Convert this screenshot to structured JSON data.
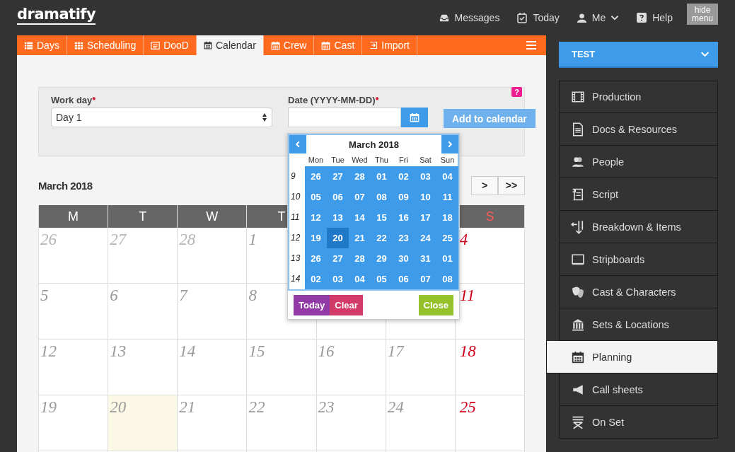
{
  "top_bar": {
    "logo": "dramatify",
    "links": [
      {
        "label": "Messages"
      },
      {
        "label": "Today"
      },
      {
        "label": "Me"
      },
      {
        "label": "Help"
      }
    ],
    "hide_menu": "hide menu"
  },
  "tabs": [
    {
      "label": "Days",
      "selected": false
    },
    {
      "label": "Scheduling",
      "selected": false
    },
    {
      "label": "DooD",
      "selected": false
    },
    {
      "label": "Calendar",
      "selected": true
    },
    {
      "label": "Crew",
      "selected": false
    },
    {
      "label": "Cast",
      "selected": false
    },
    {
      "label": "Import",
      "selected": false
    }
  ],
  "form": {
    "work_day": {
      "label": "Work day",
      "required_mark": "*",
      "value": "Day 1"
    },
    "date": {
      "label": "Date (YYYY-MM-DD)",
      "required_mark": "*"
    },
    "add_button": "Add to calendar",
    "help_badge": "?"
  },
  "calendar": {
    "title": "March 2018",
    "nav_buttons": [
      {
        "label": ">"
      },
      {
        "label": ">>"
      }
    ],
    "columns": [
      {
        "label": "M"
      },
      {
        "label": "T"
      },
      {
        "label": "W"
      },
      {
        "label": "T"
      },
      {},
      {},
      {
        "label": "S"
      }
    ],
    "weeks": [
      {
        "days": [
          {
            "day": "26",
            "other_month": true,
            "today": false
          },
          {
            "day": "27",
            "other_month": true,
            "today": false
          },
          {
            "day": "28",
            "other_month": true,
            "today": false
          },
          {
            "day": "1",
            "other_month": false,
            "today": false
          },
          {
            "day": "4",
            "other_month": false,
            "today": false
          }
        ]
      },
      {
        "days": [
          {
            "day": "5",
            "other_month": false,
            "today": false
          },
          {
            "day": "6",
            "other_month": false,
            "today": false
          },
          {
            "day": "7",
            "other_month": false,
            "today": false
          },
          {
            "day": "8",
            "other_month": false,
            "today": false
          },
          {
            "day": "11",
            "other_month": false,
            "today": false
          }
        ]
      },
      {
        "days": [
          {
            "day": "12",
            "other_month": false,
            "today": false
          },
          {
            "day": "13",
            "other_month": false,
            "today": false
          },
          {
            "day": "14",
            "other_month": false,
            "today": false
          },
          {
            "day": "15",
            "other_month": false,
            "today": false
          },
          {
            "day": "16",
            "other_month": false,
            "today": false
          },
          {
            "day": "17",
            "other_month": false,
            "today": false
          },
          {
            "day": "18",
            "other_month": false,
            "today": false
          }
        ]
      },
      {
        "days": [
          {
            "day": "19",
            "other_month": false,
            "today": false
          },
          {
            "day": "20",
            "other_month": false,
            "today": true
          },
          {
            "day": "21",
            "other_month": false,
            "today": false
          },
          {
            "day": "22",
            "other_month": false,
            "today": false
          },
          {
            "day": "23",
            "other_month": false,
            "today": false
          },
          {
            "day": "24",
            "other_month": false,
            "today": false
          },
          {
            "day": "25",
            "other_month": false,
            "today": false
          }
        ]
      }
    ]
  },
  "date_picker": {
    "title": "March 2018",
    "weekdays": [
      "Mon",
      "Tue",
      "Wed",
      "Thu",
      "Fri",
      "Sat",
      "Sun"
    ],
    "weeks": [
      {
        "number": "9",
        "days": [
          {
            "label": "26",
            "selected": false
          },
          {
            "label": "27",
            "selected": false
          },
          {
            "label": "28",
            "selected": false
          },
          {
            "label": "01",
            "selected": false
          },
          {
            "label": "02",
            "selected": false
          },
          {
            "label": "03",
            "selected": false
          },
          {
            "label": "04",
            "selected": false
          }
        ]
      },
      {
        "number": "10",
        "days": [
          {
            "label": "05",
            "selected": false
          },
          {
            "label": "06",
            "selected": false
          },
          {
            "label": "07",
            "selected": false
          },
          {
            "label": "08",
            "selected": false
          },
          {
            "label": "09",
            "selected": false
          },
          {
            "label": "10",
            "selected": false
          },
          {
            "label": "11",
            "selected": false
          }
        ]
      },
      {
        "number": "11",
        "days": [
          {
            "label": "12",
            "selected": false
          },
          {
            "label": "13",
            "selected": false
          },
          {
            "label": "14",
            "selected": false
          },
          {
            "label": "15",
            "selected": false
          },
          {
            "label": "16",
            "selected": false
          },
          {
            "label": "17",
            "selected": false
          },
          {
            "label": "18",
            "selected": false
          }
        ]
      },
      {
        "number": "12",
        "days": [
          {
            "label": "19",
            "selected": false
          },
          {
            "label": "20",
            "selected": true
          },
          {
            "label": "21",
            "selected": false
          },
          {
            "label": "22",
            "selected": false
          },
          {
            "label": "23",
            "selected": false
          },
          {
            "label": "24",
            "selected": false
          },
          {
            "label": "25",
            "selected": false
          }
        ]
      },
      {
        "number": "13",
        "days": [
          {
            "label": "26",
            "selected": false
          },
          {
            "label": "27",
            "selected": false
          },
          {
            "label": "28",
            "selected": false
          },
          {
            "label": "29",
            "selected": false
          },
          {
            "label": "30",
            "selected": false
          },
          {
            "label": "31",
            "selected": false
          },
          {
            "label": "01",
            "selected": false
          }
        ]
      },
      {
        "number": "14",
        "days": [
          {
            "label": "02",
            "selected": false
          },
          {
            "label": "03",
            "selected": false
          },
          {
            "label": "04",
            "selected": false
          },
          {
            "label": "05",
            "selected": false
          },
          {
            "label": "06",
            "selected": false
          },
          {
            "label": "07",
            "selected": false
          },
          {
            "label": "08",
            "selected": false
          }
        ]
      }
    ],
    "buttons": [
      {
        "label": "Today",
        "kind": "today"
      },
      {
        "label": "Clear",
        "kind": "clear"
      },
      {
        "label": "Close",
        "kind": "close"
      }
    ]
  },
  "sidebar": {
    "project": "TEST",
    "items": [
      {
        "label": "Production",
        "selected": false
      },
      {
        "label": "Docs & Resources",
        "selected": false
      },
      {
        "label": "People",
        "selected": false
      },
      {
        "label": "Script",
        "selected": false
      },
      {
        "label": "Breakdown & Items",
        "selected": false
      },
      {
        "label": "Stripboards",
        "selected": false
      },
      {
        "label": "Cast & Characters",
        "selected": false
      },
      {
        "label": "Sets & Locations",
        "selected": false
      },
      {
        "label": "Planning",
        "selected": true
      },
      {
        "label": "Call sheets",
        "selected": false
      },
      {
        "label": "On Set",
        "selected": false
      }
    ]
  }
}
